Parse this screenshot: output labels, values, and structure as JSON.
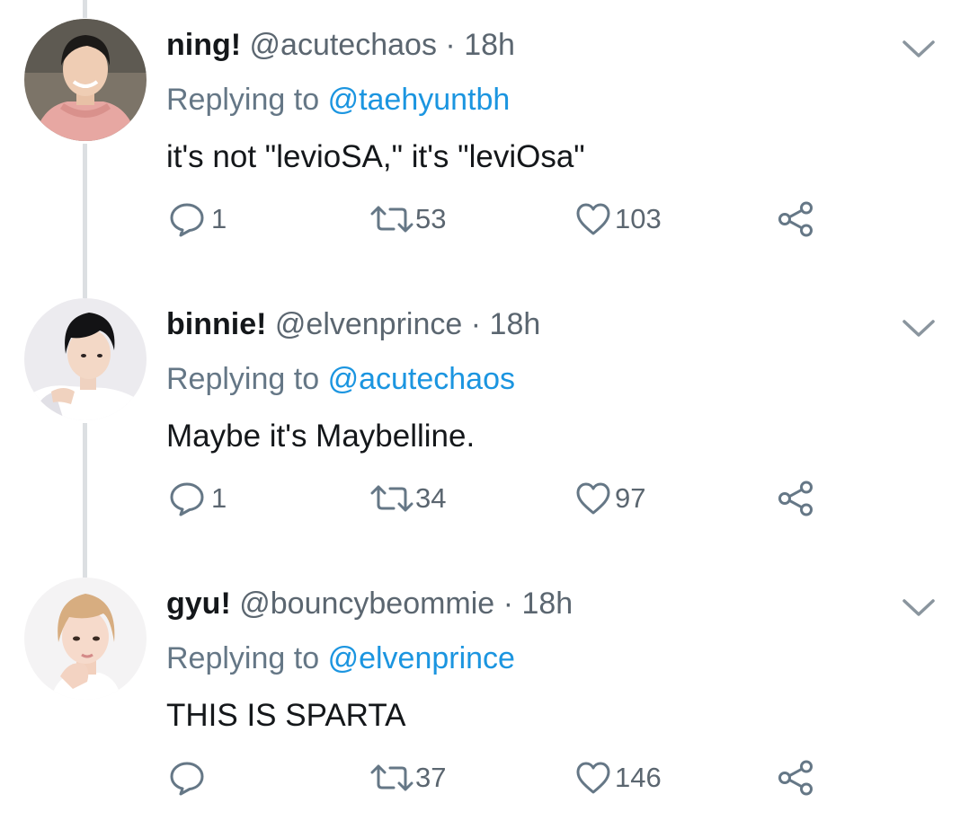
{
  "colors": {
    "text": "#14171a",
    "secondary": "#5b6670",
    "link": "#1b95e0",
    "thread_line": "#dcdfe2"
  },
  "icons": {
    "reply": "reply-icon",
    "retweet": "retweet-icon",
    "like": "heart-icon",
    "share": "share-icon",
    "menu": "chevron-down-icon"
  },
  "tweets": [
    {
      "display_name": "ning!",
      "handle": "@acutechaos",
      "separator": "·",
      "time": "18h",
      "replying_prefix": "Replying to",
      "replying_to": "@taehyuntbh",
      "text": "it's not \"levioSA,\" it's \"leviOsa\"",
      "replies": "1",
      "retweets": "53",
      "likes": "103"
    },
    {
      "display_name": "binnie!",
      "handle": "@elvenprince",
      "separator": "·",
      "time": "18h",
      "replying_prefix": "Replying to",
      "replying_to": "@acutechaos",
      "text": "Maybe it's Maybelline.",
      "replies": "1",
      "retweets": "34",
      "likes": "97"
    },
    {
      "display_name": "gyu!",
      "handle": "@bouncybeommie",
      "separator": "·",
      "time": "18h",
      "replying_prefix": "Replying to",
      "replying_to": "@elvenprince",
      "text": "THIS IS SPARTA",
      "replies": "",
      "retweets": "37",
      "likes": "146"
    }
  ]
}
